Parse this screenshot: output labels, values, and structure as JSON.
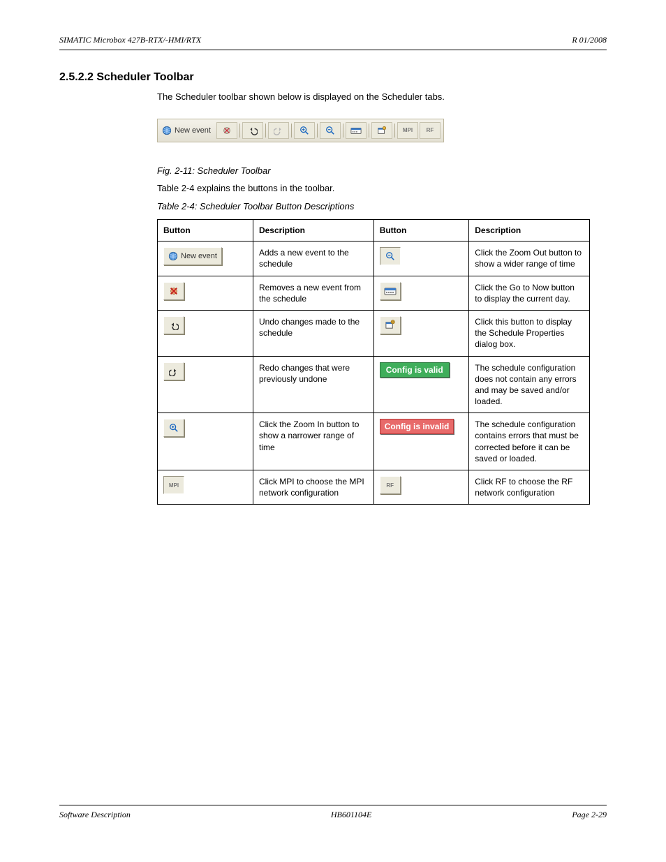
{
  "header": {
    "left": "SIMATIC Microbox 427B-RTX/-HMI/RTX",
    "right": "R 01/2008"
  },
  "section_title": "2.5.2.2  Scheduler Toolbar",
  "intro": "The Scheduler toolbar shown below is displayed on the Scheduler tabs.",
  "fig_label": "Fig.  2-11: Scheduler Toolbar",
  "toolbar": {
    "new_event": "New event",
    "mpi": "MPI",
    "rf": "RF"
  },
  "table_intro": "Table 2-4 explains the buttons in the toolbar.",
  "table_caption": "Table 2-4: Scheduler Toolbar Button Descriptions",
  "headers": {
    "button": "Button",
    "description": "Description"
  },
  "rows": [
    {
      "btn1_label": "New event",
      "desc1": "Adds a new event to the schedule",
      "desc2": "Click the Zoom Out button to show a wider range of time"
    },
    {
      "desc1": "Removes a new event from the schedule",
      "desc2": "Click the Go to Now button to display the current day."
    },
    {
      "desc1": "Undo changes made to the schedule",
      "desc2": "Click this button to display the Schedule Properties dialog box."
    },
    {
      "desc1": "Redo changes that were previously undone",
      "pill2": "Config is valid",
      "desc2": "The schedule configuration does not contain any errors and may be saved and/or loaded."
    },
    {
      "desc1": "Click the Zoom In button to show a narrower range of time",
      "pill2": "Config is invalid",
      "desc2": "The schedule configuration contains errors that must be corrected before it can be saved or loaded."
    },
    {
      "btn1_tiny": "MPI",
      "desc1": "Click MPI to choose the MPI network configuration",
      "btn2_tiny": "RF",
      "desc2": "Click RF to choose the RF network configuration"
    }
  ],
  "footer": {
    "left": "Software Description",
    "center": "HB601104E",
    "right": "Page  2-29"
  }
}
